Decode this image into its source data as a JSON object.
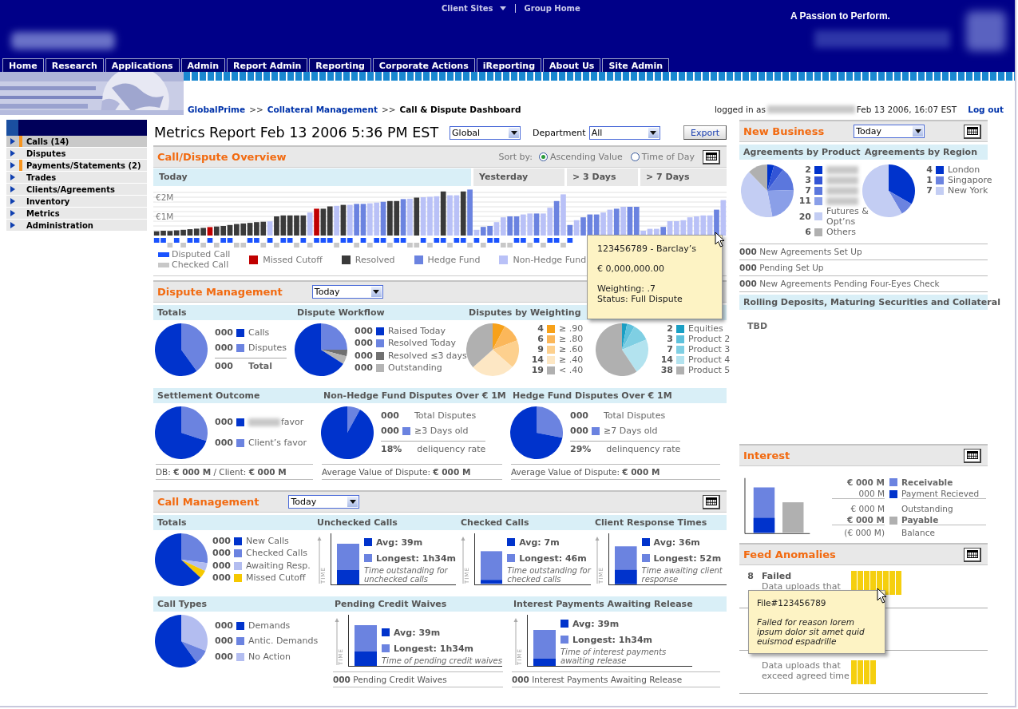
{
  "header": {
    "links": [
      {
        "label": "Client Sites",
        "kind": "dropdown"
      },
      {
        "label": "Group Home",
        "kind": "link"
      }
    ],
    "tagline": "A Passion to Perform."
  },
  "nav_tabs": [
    {
      "label": "Home",
      "selected": false
    },
    {
      "label": "Research",
      "selected": false
    },
    {
      "label": "Applications",
      "selected": false
    },
    {
      "label": "Admin",
      "selected": false
    },
    {
      "label": "Report Admin",
      "selected": false
    },
    {
      "label": "Reporting",
      "selected": false
    },
    {
      "label": "Corporate Actions",
      "selected": false
    },
    {
      "label": "iReporting",
      "selected": false
    },
    {
      "label": "About Us",
      "selected": false
    },
    {
      "label": "Site Admin",
      "selected": false
    }
  ],
  "breadcrumb": {
    "separator": ">>",
    "items": [
      {
        "label": "GlobalPrime",
        "link": true
      },
      {
        "label": "Collateral Management",
        "link": true
      },
      {
        "label": "Call & Dispute Dashboard",
        "link": false
      }
    ]
  },
  "session": {
    "prefix": "logged in as",
    "timestamp": "Feb 13 2006, 16:07 EST",
    "logout": "Log out"
  },
  "sidebar": {
    "items": [
      {
        "label": "Calls (14)",
        "flagged": true,
        "selected": true
      },
      {
        "label": "Disputes",
        "flagged": false,
        "selected": false
      },
      {
        "label": "Payments/Statements (2)",
        "flagged": true,
        "selected": false
      },
      {
        "label": "Trades",
        "flagged": false,
        "selected": false
      },
      {
        "label": "Clients/Agreements",
        "flagged": false,
        "selected": false
      },
      {
        "label": "Inventory",
        "flagged": false,
        "selected": false
      },
      {
        "label": "Metrics",
        "flagged": false,
        "selected": false
      },
      {
        "label": "Administration",
        "flagged": false,
        "selected": false
      }
    ]
  },
  "report": {
    "title": "Metrics Report Feb 13 2006 5:36 PM EST",
    "filters": [
      {
        "value": "Global"
      },
      {
        "label": "Department",
        "value": "All"
      }
    ],
    "export": "Export"
  },
  "overview": {
    "title": "Call/Dispute Overview",
    "sort_label": "Sort by:",
    "sort_options": [
      {
        "label": "Ascending Value",
        "selected": true
      },
      {
        "label": "Time of Day",
        "selected": false
      }
    ],
    "periods": [
      {
        "label": "Today",
        "selected": true
      },
      {
        "label": "Yesterday",
        "selected": false
      },
      {
        "label": "> 3 Days",
        "selected": false
      },
      {
        "label": "> 7 Days",
        "selected": false
      }
    ],
    "chart_data": {
      "type": "bar",
      "ylim": [
        0,
        2.5
      ],
      "yticks": [
        {
          "value": 1,
          "label": "€1M"
        },
        {
          "value": 2,
          "label": "€2M"
        }
      ],
      "categories": [
        null,
        null,
        null,
        null,
        null,
        null,
        null,
        null,
        null,
        null,
        null,
        null,
        null,
        null,
        null,
        null,
        null,
        null,
        null,
        null,
        null,
        null,
        null,
        null,
        null,
        null,
        null,
        null,
        null,
        null,
        null,
        null,
        null,
        null,
        null,
        null,
        null,
        null,
        null,
        null,
        null,
        null,
        null,
        null,
        null,
        null,
        null,
        null,
        null,
        null,
        null,
        null,
        null,
        null,
        null,
        null,
        null,
        null,
        null,
        null,
        null,
        null,
        null,
        null,
        null,
        null,
        null,
        null,
        null,
        null,
        null,
        null,
        null,
        null,
        null,
        null,
        null,
        null,
        null,
        null,
        null,
        null,
        null,
        null,
        null,
        null
      ],
      "values": [
        0.22,
        0.25,
        0.24,
        0.27,
        0.3,
        0.33,
        0.36,
        0.4,
        0.44,
        0.47,
        0.5,
        0.55,
        0.6,
        0.63,
        0.66,
        0.7,
        0.72,
        0.74,
        1.0,
        1.05,
        1.05,
        1.05,
        1.05,
        1.2,
        1.4,
        1.4,
        1.52,
        1.55,
        1.6,
        1.6,
        1.65,
        1.65,
        1.68,
        1.72,
        1.76,
        1.8,
        1.8,
        1.9,
        1.92,
        1.98,
        2.0,
        2.02,
        2.05,
        2.3,
        2.1,
        2.1,
        2.3,
        2.4,
        0.3,
        0.45,
        0.5,
        0.7,
        0.95,
        1.0,
        1.0,
        1.1,
        1.15,
        1.15,
        1.15,
        1.45,
        1.8,
        2.15,
        0.55,
        0.8,
        0.95,
        1.1,
        1.1,
        1.2,
        1.35,
        1.4,
        1.5,
        1.5,
        1.5,
        0.25,
        0.35,
        0.35,
        0.45,
        0.75,
        0.75,
        0.8,
        0.95,
        1.0,
        1.05,
        1.05,
        1.35,
        1.85
      ]
    },
    "bars": [
      {
        "kind": "resolved",
        "disputed": true
      },
      {
        "kind": "resolved",
        "disputed": true
      },
      {
        "kind": "resolved",
        "disputed": false
      },
      {
        "kind": "resolved",
        "disputed": true
      },
      {
        "kind": "resolved",
        "disputed": false
      },
      {
        "kind": "resolved",
        "disputed": true
      },
      {
        "kind": "resolved",
        "disputed": true
      },
      {
        "kind": "resolved",
        "disputed": false
      },
      {
        "kind": "missed",
        "disputed": true
      },
      {
        "kind": "resolved",
        "disputed": false
      },
      {
        "kind": "resolved",
        "disputed": true
      },
      {
        "kind": "resolved",
        "disputed": true
      },
      {
        "kind": "resolved",
        "disputed": false
      },
      {
        "kind": "resolved",
        "disputed": false
      },
      {
        "kind": "resolved",
        "disputed": true
      },
      {
        "kind": "resolved",
        "disputed": true
      },
      {
        "kind": "resolved",
        "disputed": false
      },
      {
        "kind": "nonhedge",
        "disputed": true
      },
      {
        "kind": "resolved",
        "disputed": false
      },
      {
        "kind": "resolved",
        "disputed": true
      },
      {
        "kind": "resolved",
        "disputed": true
      },
      {
        "kind": "resolved",
        "disputed": false
      },
      {
        "kind": "resolved",
        "disputed": true
      },
      {
        "kind": "nonhedge",
        "disputed": false
      },
      {
        "kind": "missed",
        "disputed": true
      },
      {
        "kind": "resolved",
        "disputed": true
      },
      {
        "kind": "resolved",
        "disputed": true
      },
      {
        "kind": "nonhedge",
        "disputed": false
      },
      {
        "kind": "resolved",
        "disputed": true
      },
      {
        "kind": "nonhedge",
        "disputed": true
      },
      {
        "kind": "hedge",
        "disputed": false
      },
      {
        "kind": "hedge",
        "disputed": true
      },
      {
        "kind": "nonhedge",
        "disputed": false
      },
      {
        "kind": "nonhedge",
        "disputed": true
      },
      {
        "kind": "hedge",
        "disputed": true
      },
      {
        "kind": "resolved",
        "disputed": false
      },
      {
        "kind": "resolved",
        "disputed": true
      },
      {
        "kind": "hedge",
        "disputed": true
      },
      {
        "kind": "nonhedge",
        "disputed": false
      },
      {
        "kind": "resolved",
        "disputed": false
      },
      {
        "kind": "nonhedge",
        "disputed": true
      },
      {
        "kind": "nonhedge",
        "disputed": false
      },
      {
        "kind": "nonhedge",
        "disputed": true
      },
      {
        "kind": "resolved",
        "disputed": true
      },
      {
        "kind": "nonhedge",
        "disputed": false
      },
      {
        "kind": "nonhedge",
        "disputed": true
      },
      {
        "kind": "resolved",
        "disputed": true
      },
      {
        "kind": "hedge",
        "disputed": false
      },
      {
        "kind": "nonhedge",
        "disputed": true
      },
      {
        "kind": "hedge",
        "disputed": false
      },
      {
        "kind": "hedge",
        "disputed": true
      },
      {
        "kind": "nonhedge",
        "disputed": true
      },
      {
        "kind": "nonhedge",
        "disputed": false
      },
      {
        "kind": "hedge",
        "disputed": false
      },
      {
        "kind": "hedge",
        "disputed": true
      },
      {
        "kind": "nonhedge",
        "disputed": true
      },
      {
        "kind": "nonhedge",
        "disputed": false
      },
      {
        "kind": "hedge",
        "disputed": true
      },
      {
        "kind": "nonhedge",
        "disputed": false
      },
      {
        "kind": "nonhedge",
        "disputed": true
      },
      {
        "kind": "hedge",
        "disputed": true
      },
      {
        "kind": "nonhedge",
        "disputed": false
      },
      {
        "kind": "hedge",
        "disputed": true
      },
      {
        "kind": "nonhedge"
      },
      {
        "kind": "hedge"
      },
      {
        "kind": "hedge"
      },
      {
        "kind": "hedge"
      },
      {
        "kind": "nonhedge"
      },
      {
        "kind": "nonhedge"
      },
      {
        "kind": "hedge"
      },
      {
        "kind": "nonhedge"
      },
      {
        "kind": "hedge"
      },
      {
        "kind": "hedge"
      },
      {
        "kind": "nonhedge"
      },
      {
        "kind": "nonhedge"
      },
      {
        "kind": "nonhedge"
      },
      {
        "kind": "hedge"
      },
      {
        "kind": "nonhedge"
      },
      {
        "kind": "nonhedge"
      },
      {
        "kind": "nonhedge"
      },
      {
        "kind": "nonhedge"
      },
      {
        "kind": "nonhedge"
      },
      {
        "kind": "nonhedge"
      },
      {
        "kind": "nonhedge"
      },
      {
        "kind": "hedge"
      },
      {
        "kind": "nonhedge"
      }
    ],
    "legend": [
      {
        "label": "Disputed Call",
        "kind": "mark",
        "color": "#1a53ff"
      },
      {
        "label": "Checked Call",
        "kind": "mark",
        "color": "#c8c8c8"
      },
      {
        "label": "Missed Cutoff",
        "kind": "swatch",
        "color": "#c00000"
      },
      {
        "label": "Resolved",
        "kind": "swatch",
        "color": "#3a3a3a"
      },
      {
        "label": "Hedge Fund",
        "kind": "swatch",
        "color": "#6b83e0"
      },
      {
        "label": "Non-Hedge Fund",
        "kind": "swatch",
        "color": "#b9c1f7"
      }
    ],
    "tooltip": {
      "paragraphs": [
        {
          "kind": "plain",
          "lines": [
            "123456789 - Barclay’s"
          ]
        },
        {
          "kind": "plain",
          "lines": [
            "€ 0,000,000.00"
          ]
        },
        {
          "kind": "plain",
          "lines": [
            "Weighting: .7",
            "Status: Full Dispute"
          ]
        }
      ]
    }
  },
  "dispute_management": {
    "title": "Dispute Management",
    "period": "Today",
    "rows": [
      {
        "blocks": [
          {
            "kind": "pie",
            "title": "Totals",
            "legend": [
              {
                "count": "000",
                "label": "Calls",
                "color": "#0033cc"
              },
              {
                "count": "000",
                "label": "Disputes",
                "color": "#6b83e0"
              }
            ],
            "total": {
              "kind": "sum",
              "count": "000",
              "label": "Total"
            }
          },
          {
            "kind": "pie",
            "title": "Dispute Workflow",
            "legend": [
              {
                "count": "000",
                "label": "Raised Today",
                "color": "#0033cc"
              },
              {
                "count": "000",
                "label": "Resolved Today",
                "color": "#6b83e0"
              },
              {
                "count": "000",
                "label": "Resolved ≤3 days",
                "color": "#707070"
              },
              {
                "count": "000",
                "label": "Outstanding",
                "color": "#b4b4b4"
              }
            ]
          },
          {
            "kind": "chart_pie",
            "title": "Disputes by Weighting",
            "chart_data": {
              "type": "pie",
              "values": [
                7.7,
                11.5,
                17.3,
                26.9,
                36.6
              ]
            },
            "legend": [
              {
                "count": "4",
                "label": "≥ .90",
                "color": "#f7a11a"
              },
              {
                "count": "6",
                "label": "≥ .80",
                "color": "#fbb75a"
              },
              {
                "count": "9",
                "label": "≥ .60",
                "color": "#fdd08e"
              },
              {
                "count": "14",
                "label": "≥ .40",
                "color": "#fde7c4"
              },
              {
                "count": "19",
                "label": "< .40",
                "color": "#b0b0b0"
              }
            ]
          },
          {
            "kind": "chart_pie",
            "chart_data": {
              "type": "pie",
              "values": [
                3.1,
                4.7,
                10.9,
                21.9,
                59.4
              ]
            },
            "legend": [
              {
                "count": "2",
                "label": "Equities",
                "color": "#1a9fc4"
              },
              {
                "count": "3",
                "label": "Product 2",
                "color": "#5ec1dc"
              },
              {
                "count": "7",
                "label": "Product 3",
                "color": "#7fcfe3"
              },
              {
                "count": "14",
                "label": "Product 4",
                "color": "#b3e3ef"
              },
              {
                "count": "38",
                "label": "Product 5",
                "color": "#b0b0b0"
              }
            ]
          }
        ]
      },
      {
        "blocks": [
          {
            "kind": "pie",
            "title": "Settlement Outcome",
            "legend": [
              {
                "count": "000",
                "label": "favor",
                "color": "#0033cc",
                "redacted": true
              },
              {
                "count": "000",
                "label": "Client’s favor",
                "color": "#6b83e0"
              }
            ],
            "footer": "DB: **€ 000 M**  /  Client: **€ 000 M**"
          },
          {
            "kind": "pie",
            "title": "Non-Hedge Fund Disputes Over € 1M",
            "legend": [
              {
                "count": "000",
                "label": "Total Disputes"
              },
              {
                "count": "000",
                "label": "≥3 Days old",
                "color": "#6b83e0"
              }
            ],
            "total": {
              "kind": "rate",
              "count": "18%",
              "label": "deliquency rate"
            },
            "footer": "Average Value of Dispute:  **€ 000 M**"
          },
          {
            "kind": "pie",
            "title": "Hedge Fund Disputes Over € 1M",
            "legend": [
              {
                "count": "000",
                "label": "Total Disputes"
              },
              {
                "count": "000",
                "label": "≥7 Days old",
                "color": "#6b83e0"
              }
            ],
            "total": {
              "kind": "rate",
              "count": "29%",
              "label": "delinquency rate"
            },
            "footer": "Average Value of Dispute:  **€ 000 M**"
          }
        ]
      }
    ]
  },
  "call_management": {
    "title": "Call Management",
    "period": "Today",
    "rows": [
      {
        "blocks": [
          {
            "kind": "pie",
            "title": "Totals",
            "legend": [
              {
                "count": "000",
                "label": "New Calls",
                "color": "#0033cc"
              },
              {
                "count": "000",
                "label": "Checked Calls",
                "color": "#6b83e0"
              },
              {
                "count": "000",
                "label": "Awaiting Resp.",
                "color": "#b3bdf0"
              },
              {
                "count": "000",
                "label": "Missed Cutoff",
                "color": "#f5c800"
              }
            ]
          },
          {
            "kind": "time",
            "title": "Unchecked Calls",
            "axis": "TIME",
            "legend": [
              {
                "label": "Avg: 39m",
                "color": "#0033cc"
              },
              {
                "label": "Longest: 1h34m",
                "color": "#6b83e0"
              }
            ],
            "note": "Time outstanding for unchecked calls"
          },
          {
            "kind": "time",
            "title": "Checked Calls",
            "axis": "TIME",
            "legend": [
              {
                "label": "Avg: 7m",
                "color": "#0033cc"
              },
              {
                "label": "Longest: 46m",
                "color": "#6b83e0"
              }
            ],
            "note": "Time outstanding for checked calls"
          },
          {
            "kind": "time",
            "title": "Client Response Times",
            "axis": "TIME",
            "legend": [
              {
                "label": "Avg: 36m",
                "color": "#0033cc"
              },
              {
                "label": "Longest: 52m",
                "color": "#6b83e0"
              }
            ],
            "note": "Time awaiting client response"
          }
        ]
      },
      {
        "blocks": [
          {
            "kind": "pie",
            "title": "Call Types",
            "legend": [
              {
                "count": "000",
                "label": "Demands",
                "color": "#0033cc"
              },
              {
                "count": "000",
                "label": "Antic. Demands",
                "color": "#6b83e0"
              },
              {
                "count": "000",
                "label": "No Action",
                "color": "#b3bdf0"
              }
            ]
          },
          {
            "kind": "time",
            "title": "Pending Credit Waives",
            "axis": "TIME",
            "legend": [
              {
                "label": "Avg: 39m",
                "color": "#0033cc"
              },
              {
                "label": "Longest: 1h34m",
                "color": "#6b83e0"
              }
            ],
            "note": "Time of pending credit waives",
            "footer": "**000** Pending Credit Waives"
          },
          {
            "kind": "time",
            "title": "Interest Payments Awaiting Release",
            "axis": "TIME",
            "legend": [
              {
                "label": "Avg: 39m",
                "color": "#0033cc"
              },
              {
                "label": "Longest: 1h34m",
                "color": "#6b83e0"
              }
            ],
            "note": "Time of interest payments awaiting release",
            "footer": "**000** Interest Payments Awaiting Release"
          }
        ]
      }
    ]
  },
  "new_business": {
    "title": "New Business",
    "period": "Today",
    "columns": [
      {
        "title": "Agreements by Product",
        "chart_data": {
          "type": "pie",
          "values": [
            4.1,
            6.1,
            14.3,
            22.4,
            40.9,
            12.2
          ]
        },
        "legend": [
          {
            "count": "2",
            "color": "#0033cc",
            "redacted": true
          },
          {
            "count": "3",
            "color": "#3355d6",
            "redacted": true
          },
          {
            "count": "7",
            "color": "#5b77dd",
            "redacted": true
          },
          {
            "count": "11",
            "color": "#8a9fe8",
            "redacted": true
          },
          {
            "count": "20",
            "label": "Futures & Opt’ns",
            "color": "#c3cdf3"
          },
          {
            "count": "6",
            "label": "Others",
            "color": "#b0b0b0"
          }
        ]
      },
      {
        "title": "Agreements by Region",
        "chart_data": {
          "type": "pie",
          "values": [
            33.3,
            8.3,
            58.4
          ]
        },
        "legend": [
          {
            "count": "4",
            "label": "London",
            "color": "#0033cc"
          },
          {
            "count": "1",
            "label": "Singapore",
            "color": "#6b83e0"
          },
          {
            "count": "7",
            "label": "New York",
            "color": "#c3cdf3"
          }
        ]
      }
    ],
    "stats": [
      "**000** New Agreements Set Up",
      "**000** Pending Set Up",
      "**000** New Agreements Pending Four-Eyes Check"
    ],
    "rolling": {
      "title": "Rolling Deposits, Maturing Securities and Collateral",
      "body": "TBD"
    }
  },
  "interest": {
    "title": "Interest",
    "lines": [
      {
        "amount": "€ 000 M",
        "label": "Receivable",
        "color": "#6b83e0",
        "kind": "major",
        "rule_below": false
      },
      {
        "amount": "000 M",
        "label": "Payment Recieved",
        "color": "#0033cc",
        "kind": "minor",
        "rule_below": true
      },
      {
        "amount": "€ 000 M",
        "label": "Outstanding",
        "kind": "minor",
        "rule_below": false
      },
      {
        "amount": "€ 000 M",
        "label": "Payable",
        "color": "#b0b0b0",
        "kind": "major",
        "rule_below": true
      },
      {
        "amount": "(€ 000 M)",
        "label": "Balance",
        "kind": "minor",
        "rule_below": false
      }
    ]
  },
  "feed_anomalies": {
    "title": "Feed Anomalies",
    "rows": [
      {
        "count": "8",
        "label": "Failed",
        "note": "Data uploads that"
      },
      {
        "note": "Data uploads that exceed agreed time"
      }
    ],
    "tooltip": {
      "paragraphs": [
        {
          "kind": "plain",
          "lines": [
            "File#123456789"
          ]
        },
        {
          "kind": "note",
          "lines": [
            "Failed for reason lorem ipsum dolor sit amet quid euismod espadrille"
          ]
        }
      ]
    }
  }
}
